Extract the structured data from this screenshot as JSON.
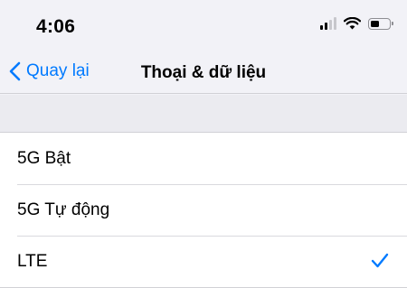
{
  "status_bar": {
    "time": "4:06",
    "icons": [
      "cellular-signal-icon",
      "wifi-icon",
      "battery-icon"
    ],
    "battery_level": 0.35
  },
  "nav": {
    "back_label": "Quay lại",
    "title": "Thoại & dữ liệu"
  },
  "options": [
    {
      "label": "5G Bật",
      "selected": false
    },
    {
      "label": "5G Tự động",
      "selected": false
    },
    {
      "label": "LTE",
      "selected": true
    }
  ],
  "colors": {
    "accent": "#007aff",
    "background": "#f2f2f7",
    "cell": "#ffffff"
  }
}
